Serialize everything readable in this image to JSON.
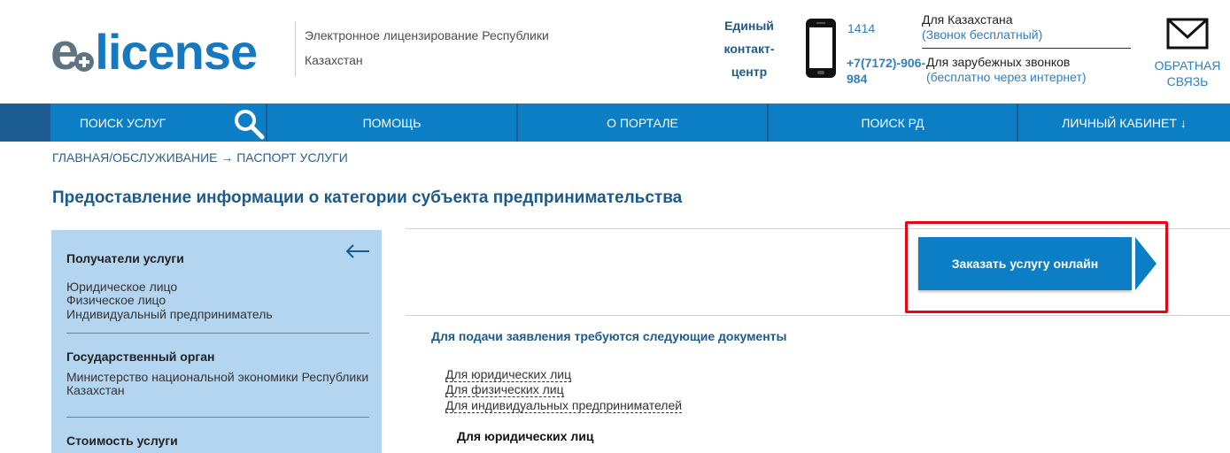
{
  "header": {
    "logo": {
      "e": "e",
      "license": "license"
    },
    "tagline": "Электронное лицензирование Республики Казахстан",
    "contact_center": "Единый контакт-центр",
    "phone_local": "1414",
    "phone_intl": "+7(7172)-906-984",
    "kz_label": "Для Казахстана",
    "kz_sub": "(Звонок бесплатный)",
    "intl_label": "Для зарубежных звонков",
    "intl_sub": "(бесплатно через интернет)",
    "feedback": "ОБРАТНАЯ СВЯЗЬ",
    "icons": {
      "phone": "mobile-phone-icon",
      "mail": "envelope-icon"
    }
  },
  "nav": {
    "items": [
      {
        "label": "ПОИСК УСЛУГ"
      },
      {
        "label": "ПОМОЩЬ"
      },
      {
        "label": "О ПОРТАЛЕ"
      },
      {
        "label": "ПОИСК РД"
      },
      {
        "label": "ЛИЧНЫЙ КАБИНЕТ ↓"
      }
    ],
    "search_icon": "magnifier-icon"
  },
  "breadcrumb": "ГЛАВНАЯ/ОБСЛУЖИВАНИЕ → ПАСПОРТ УСЛУГИ",
  "page_title": "Предоставление информации о категории субъекта предпринимательства",
  "sidebar": {
    "sections": [
      {
        "heading": "Получатели услуги",
        "lines": [
          "Юридическое лицо",
          "Физическое лицо",
          "Индивидуальный предприниматель"
        ]
      },
      {
        "heading": "Государственный орган",
        "lines": [
          "Министерство национальной экономики Республики",
          "Казахстан"
        ]
      },
      {
        "heading": "Стоимость услуги",
        "lines": []
      }
    ],
    "back_icon": "arrow-left-icon"
  },
  "main": {
    "order_button": "Заказать услугу онлайн",
    "docs_heading": "Для подачи заявления требуются следующие документы",
    "doc_links": [
      "Для юридических лиц",
      "Для физических лиц",
      "Для индивидуальных предпринимателей"
    ],
    "docs_subheading": "Для юридических лиц"
  },
  "colors": {
    "brand_blue": "#0b7ec6",
    "dark_blue": "#1c5d93",
    "sidebar_bg": "#b4d5f0",
    "highlight_red": "#e30613"
  }
}
